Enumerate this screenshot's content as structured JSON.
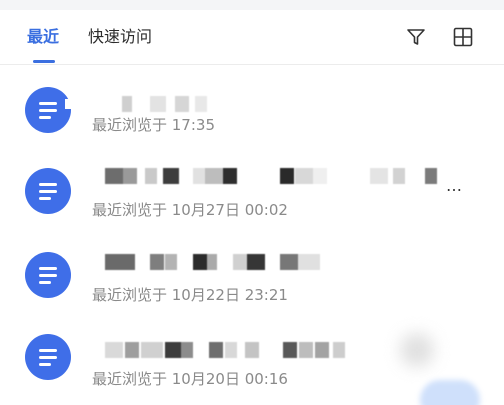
{
  "tabs": [
    {
      "label": "最近"
    },
    {
      "label": "快速访问"
    }
  ],
  "toolbar": {
    "filter_icon": "filter-icon",
    "grid_icon": "grid-view-icon"
  },
  "files": [
    {
      "meta": "最近浏览于 17:35"
    },
    {
      "meta": "最近浏览于 10月27日 00:02",
      "more": "…"
    },
    {
      "meta": "最近浏览于 10月22日 23:21"
    },
    {
      "meta": "最近浏览于 10月20日 00:16"
    }
  ],
  "colors": {
    "accent": "#3b6fe0",
    "doc_icon": "#3f6ee8",
    "meta_text": "#8a8a8a"
  }
}
